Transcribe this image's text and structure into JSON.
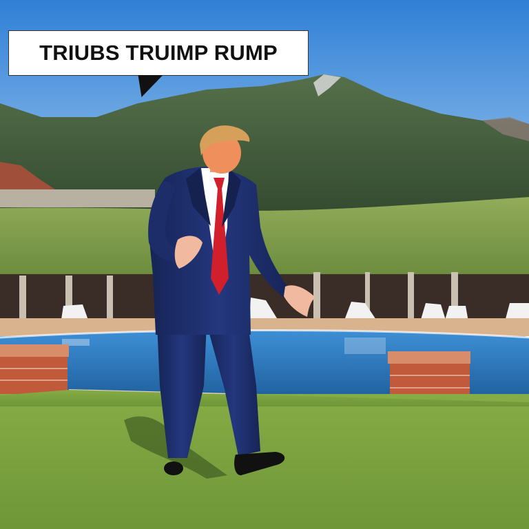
{
  "speech_bubble": {
    "text": "TRIUBS TRUIMP RUMP"
  },
  "colors": {
    "sky_top": "#2f7fd6",
    "sky_bottom": "#9fc8ee",
    "mountain": "#3f5a3c",
    "hedge": "#7b9a48",
    "pool_water": "#2f7fc4",
    "brick": "#c3603f",
    "lawn": "#7aa03f",
    "suit": "#1f2f6e",
    "tie": "#d11f2b"
  },
  "scene": {
    "subjects": [
      "figure-in-suit",
      "swimming-pool",
      "hedge-pergola",
      "mountains",
      "lawn",
      "lounge-chairs"
    ]
  }
}
